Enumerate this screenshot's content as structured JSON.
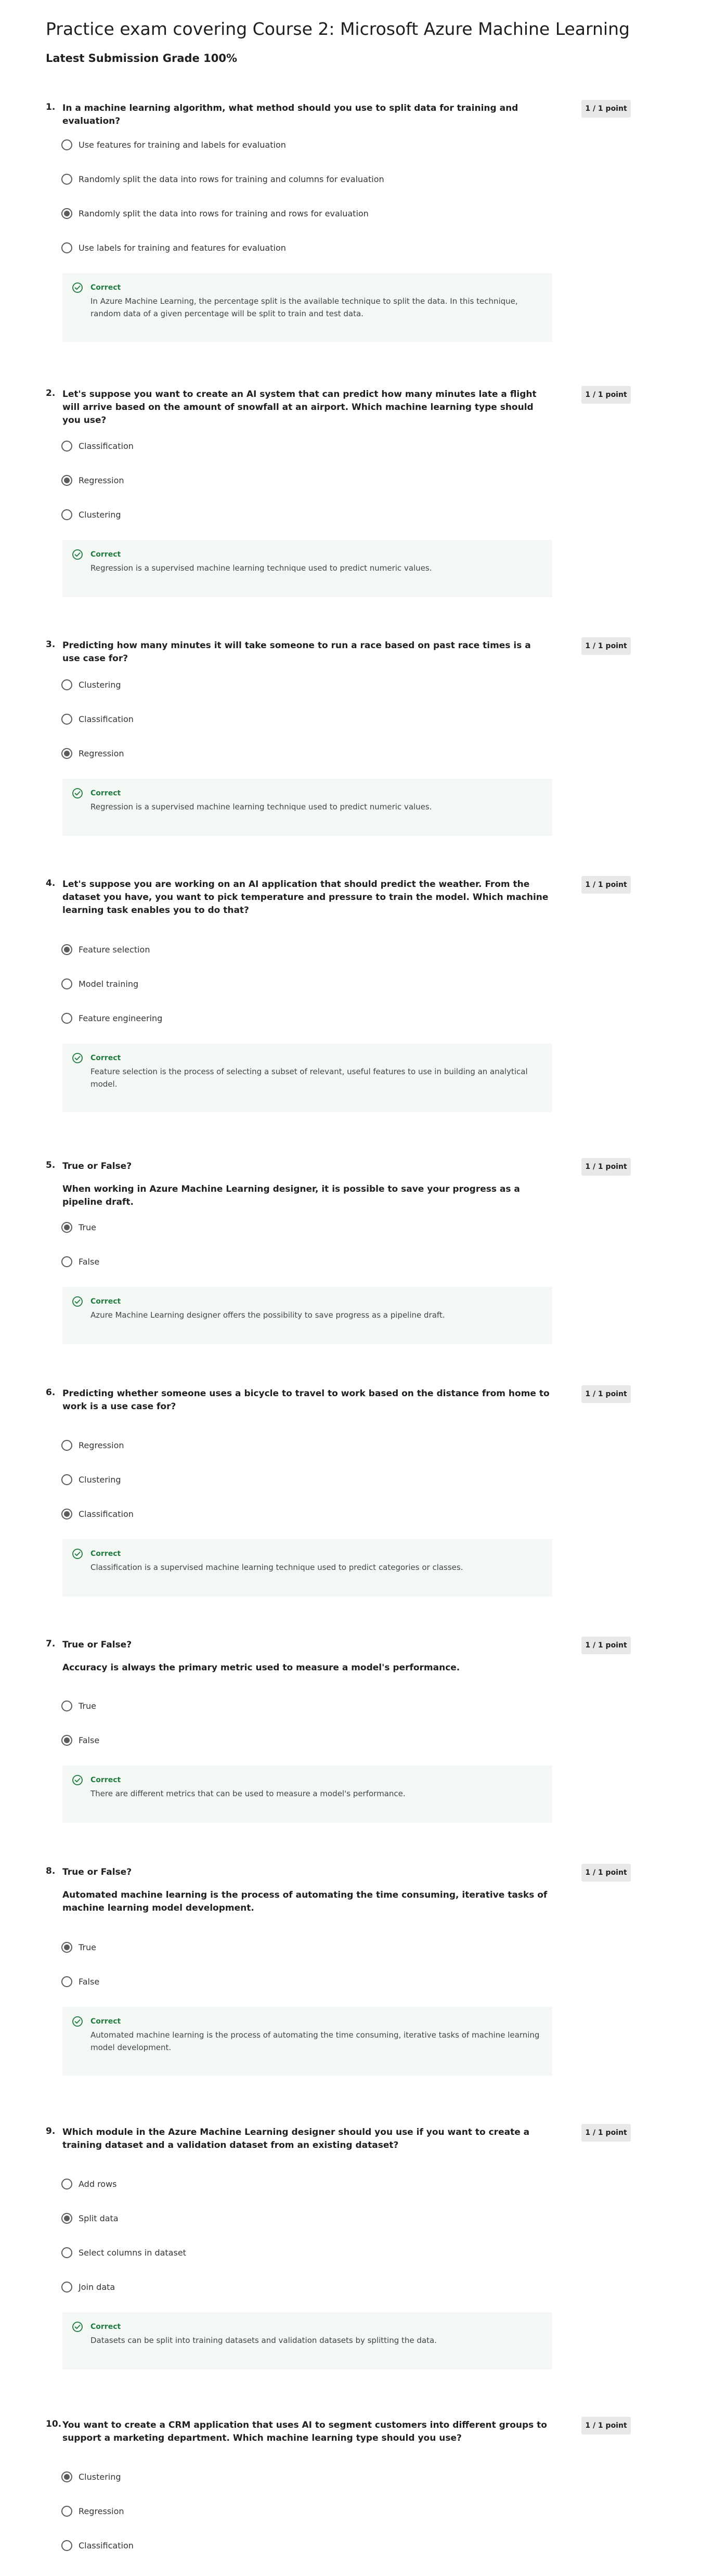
{
  "page": {
    "title": "Practice exam covering Course 2: Microsoft Azure Machine Learning",
    "grade": "Latest Submission Grade 100%"
  },
  "questions": [
    {
      "number": "1.",
      "text": "In a machine learning algorithm, what method should you use to split data for training and evaluation?",
      "points": "1 / 1 point",
      "options": [
        "Use features for training and labels for evaluation",
        "Randomly split the data into rows for training and columns for evaluation",
        "Randomly split the data into rows for training and rows for evaluation",
        "Use labels for training and features for evaluation"
      ],
      "selected_option": "Randomly split the data into rows for training and rows for evaluation",
      "feedback_label": "Correct",
      "feedback": "In Azure Machine Learning, the percentage split is the available technique to split the data. In this technique, random data of a given percentage will be split to train and test data."
    },
    {
      "number": "2.",
      "text": "Let's suppose you want to create an AI system that can predict how many minutes late a flight will arrive based on the amount of snowfall at an airport. Which machine learning type should you use?",
      "points": "1 / 1 point",
      "options": [
        "Classification",
        "Regression",
        "Clustering"
      ],
      "selected_option": "Regression",
      "feedback_label": "Correct",
      "feedback": "Regression is a supervised machine learning technique used to predict numeric values."
    },
    {
      "number": "3.",
      "text": "Predicting how many minutes it will take someone to run a race based on past race times is a use case for?",
      "points": "1 / 1 point",
      "options": [
        "Clustering",
        "Classification",
        "Regression"
      ],
      "selected_option": "Regression",
      "feedback_label": "Correct",
      "feedback": "Regression is a supervised machine learning technique used to predict numeric values."
    },
    {
      "number": "4.",
      "text": "Let's suppose you are working on an AI application that should predict the weather. From the dataset you have, you want to pick temperature and pressure to train the model. Which machine learning task enables you to do that?",
      "points": "1 / 1 point",
      "options": [
        "Feature selection",
        "Model training",
        "Feature engineering"
      ],
      "selected_option": "Feature selection",
      "feedback_label": "Correct",
      "feedback": "Feature selection is the process of selecting a subset of relevant, useful features to use in building an analytical model."
    },
    {
      "number": "5.",
      "text": "True or False?",
      "subtext": "When working in Azure Machine Learning designer, it is possible to save your progress as a pipeline draft.",
      "points": "1 / 1 point",
      "options": [
        "True",
        "False"
      ],
      "selected_option": "True",
      "feedback_label": "Correct",
      "feedback": "Azure Machine Learning designer offers the possibility to save progress as a pipeline draft."
    },
    {
      "number": "6.",
      "text": "Predicting whether someone uses a bicycle to travel to work based on the distance from home to work is a use case for?",
      "points": "1 / 1 point",
      "options": [
        "Regression",
        "Clustering",
        "Classification"
      ],
      "selected_option": "Classification",
      "feedback_label": "Correct",
      "feedback": "Classification is a supervised machine learning technique used to predict categories or classes."
    },
    {
      "number": "7.",
      "text": "True or False?",
      "subtext": "Accuracy is always the primary metric used to measure a model's performance.",
      "points": "1 / 1 point",
      "options": [
        "True",
        "False"
      ],
      "selected_option": "False",
      "feedback_label": "Correct",
      "feedback": "There are different metrics that can be used to measure a model's performance."
    },
    {
      "number": "8.",
      "text": "True or False?",
      "subtext": "Automated machine learning is the process of automating the time consuming, iterative tasks of machine learning model development.",
      "points": "1 / 1 point",
      "options": [
        "True",
        "False"
      ],
      "selected_option": "True",
      "feedback_label": "Correct",
      "feedback": "Automated machine learning is the process of automating the time consuming, iterative tasks of machine learning model development."
    },
    {
      "number": "9.",
      "text": "Which module in the Azure Machine Learning designer should you use if you want to create a training dataset and a validation dataset from an existing dataset?",
      "points": "1 / 1 point",
      "options": [
        "Add rows",
        "Split data",
        "Select columns in dataset",
        "Join data"
      ],
      "selected_option": "Split data",
      "feedback_label": "Correct",
      "feedback": "Datasets can be split into training datasets and validation datasets by splitting the data."
    },
    {
      "number": "10.",
      "text": "You want to create a CRM application that uses AI to segment customers into different groups to support a marketing department. Which machine learning type should you use?",
      "points": "1 / 1 point",
      "options": [
        "Clustering",
        "Regression",
        "Classification"
      ],
      "selected_option": "Clustering"
    }
  ]
}
